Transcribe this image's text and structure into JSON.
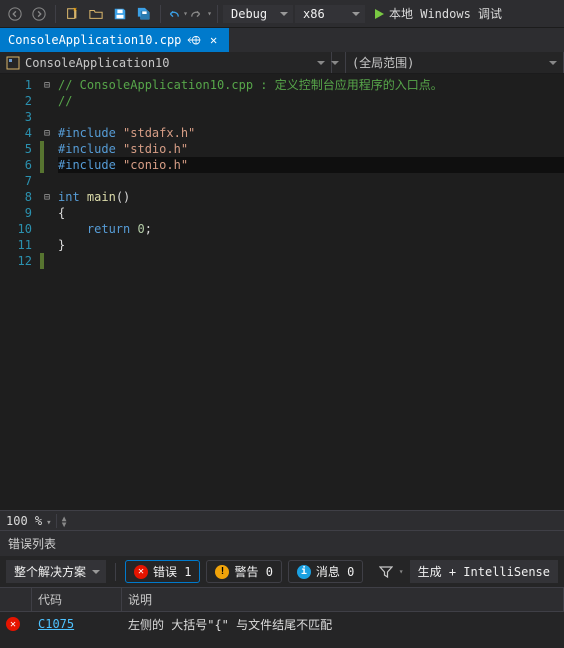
{
  "toolbar": {
    "config": "Debug",
    "platform": "x86",
    "run_label": "本地 Windows 调试"
  },
  "tab": {
    "name": "ConsoleApplication10.cpp"
  },
  "navbar": {
    "scope": "ConsoleApplication10",
    "right": "(全局范围)"
  },
  "code": {
    "lines": [
      {
        "n": "1",
        "fold": "⊟",
        "segs": [
          [
            "c-comment",
            "// ConsoleApplication10.cpp : 定义控制台应用程序的入口点。"
          ]
        ]
      },
      {
        "n": "2",
        "segs": [
          [
            "c-comment",
            "//"
          ]
        ]
      },
      {
        "n": "3",
        "segs": []
      },
      {
        "n": "4",
        "fold": "⊟",
        "segs": [
          [
            "c-keyword",
            "#include "
          ],
          [
            "c-string",
            "\"stdafx.h\""
          ]
        ]
      },
      {
        "n": "5",
        "mod": true,
        "segs": [
          [
            "c-keyword",
            "#include "
          ],
          [
            "c-string",
            "\"stdio.h\""
          ]
        ]
      },
      {
        "n": "6",
        "mod": true,
        "hl": true,
        "segs": [
          [
            "c-keyword",
            "#include "
          ],
          [
            "c-string",
            "\"conio.h\""
          ]
        ]
      },
      {
        "n": "7",
        "segs": []
      },
      {
        "n": "8",
        "fold": "⊟",
        "segs": [
          [
            "c-keyword",
            "int "
          ],
          [
            "c-func",
            "main"
          ],
          [
            "c-plain",
            "()"
          ]
        ]
      },
      {
        "n": "9",
        "segs": [
          [
            "c-plain",
            "{"
          ]
        ]
      },
      {
        "n": "10",
        "segs": [
          [
            "c-plain",
            "    "
          ],
          [
            "c-keyword",
            "return"
          ],
          [
            "c-plain",
            " "
          ],
          [
            "c-num",
            "0"
          ],
          [
            "c-plain",
            ";"
          ]
        ]
      },
      {
        "n": "11",
        "segs": [
          [
            "c-plain",
            "}"
          ]
        ]
      },
      {
        "n": "12",
        "mod": true,
        "segs": []
      }
    ]
  },
  "zoom": {
    "level": "100 %"
  },
  "errlist": {
    "title": "错误列表",
    "scope": "整个解决方案",
    "pills": {
      "errors": "错误 1",
      "warnings": "警告 0",
      "messages": "消息 0"
    },
    "build": "生成 + IntelliSense",
    "headers": {
      "code": "代码",
      "desc": "说明"
    },
    "rows": [
      {
        "code": "C1075",
        "desc": "左侧的 大括号\"{\" 与文件结尾不匹配"
      }
    ]
  }
}
